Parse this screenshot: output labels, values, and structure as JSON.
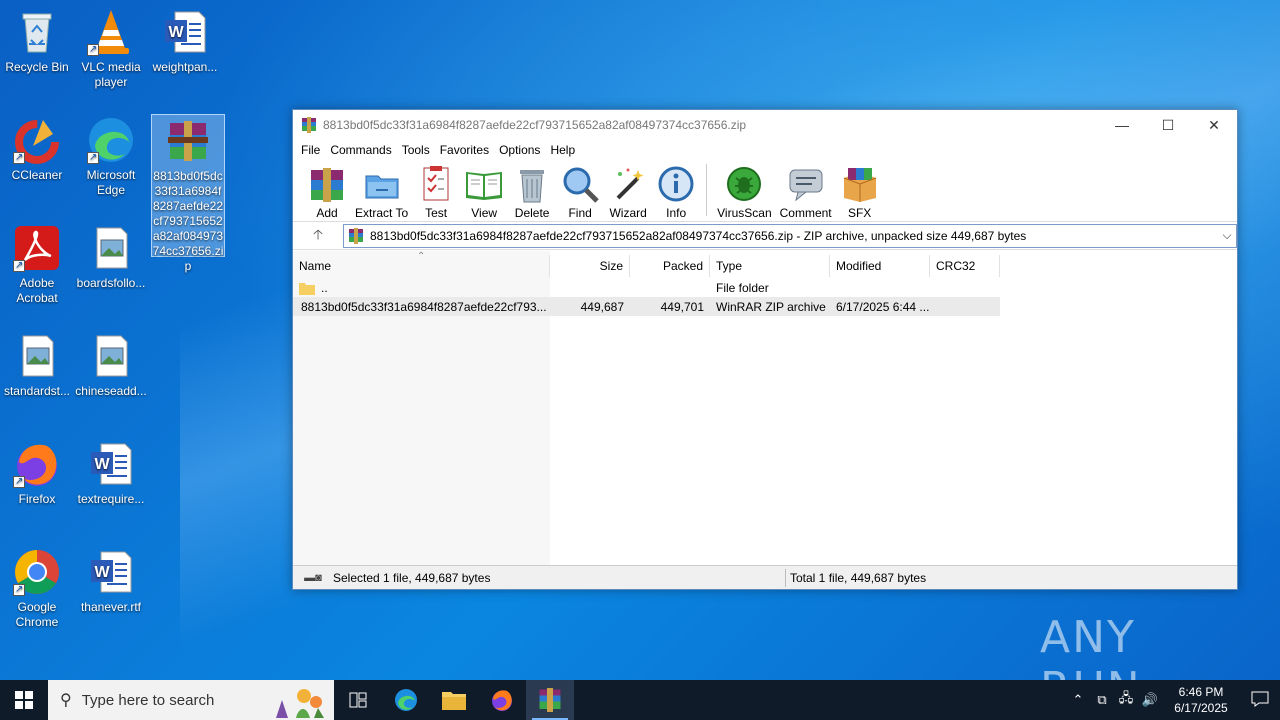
{
  "desktop": {
    "icons": [
      {
        "label": "Recycle Bin"
      },
      {
        "label": "VLC media player"
      },
      {
        "label": "weightpan..."
      },
      {
        "label": "CCleaner"
      },
      {
        "label": "Microsoft Edge"
      },
      {
        "label": "8813bd0f5dc33f31a6984f8287aefde22cf793715652a82af08497374cc37656.zip"
      },
      {
        "label": "Adobe Acrobat"
      },
      {
        "label": "boardsfollo..."
      },
      {
        "label": "standardst..."
      },
      {
        "label": "chineseadd..."
      },
      {
        "label": "Firefox"
      },
      {
        "label": "textrequire..."
      },
      {
        "label": "Google Chrome"
      },
      {
        "label": "thanever.rtf"
      }
    ]
  },
  "window": {
    "title": "8813bd0f5dc33f31a6984f8287aefde22cf793715652a82af08497374cc37656.zip",
    "menu": [
      "File",
      "Commands",
      "Tools",
      "Favorites",
      "Options",
      "Help"
    ],
    "toolbar": [
      {
        "label": "Add",
        "icon": "add-icon"
      },
      {
        "label": "Extract To",
        "icon": "extract-to-icon"
      },
      {
        "label": "Test",
        "icon": "test-icon"
      },
      {
        "label": "View",
        "icon": "view-icon"
      },
      {
        "label": "Delete",
        "icon": "delete-icon"
      },
      {
        "label": "Find",
        "icon": "find-icon"
      },
      {
        "label": "Wizard",
        "icon": "wizard-icon"
      },
      {
        "label": "Info",
        "icon": "info-icon"
      },
      {
        "label": "VirusScan",
        "icon": "virusscan-icon"
      },
      {
        "label": "Comment",
        "icon": "comment-icon"
      },
      {
        "label": "SFX",
        "icon": "sfx-icon"
      }
    ],
    "address": "8813bd0f5dc33f31a6984f8287aefde22cf793715652a82af08497374cc37656.zip - ZIP archive, unpacked size 449,687 bytes",
    "columns": [
      "Name",
      "Size",
      "Packed",
      "Type",
      "Modified",
      "CRC32"
    ],
    "rows": [
      {
        "name": "..",
        "size": "",
        "packed": "",
        "type": "File folder",
        "modified": "",
        "crc": ""
      },
      {
        "name": "8813bd0f5dc33f31a6984f8287aefde22cf793...",
        "size": "449,687",
        "packed": "449,701",
        "type": "WinRAR ZIP archive",
        "modified": "6/17/2025 6:44 ...",
        "crc": ""
      }
    ],
    "status_left": "Selected 1 file, 449,687 bytes",
    "status_right": "Total 1 file, 449,687 bytes"
  },
  "watermark": "ANY RUN",
  "taskbar": {
    "search_placeholder": "Type here to search",
    "time": "6:46 PM",
    "date": "6/17/2025"
  }
}
